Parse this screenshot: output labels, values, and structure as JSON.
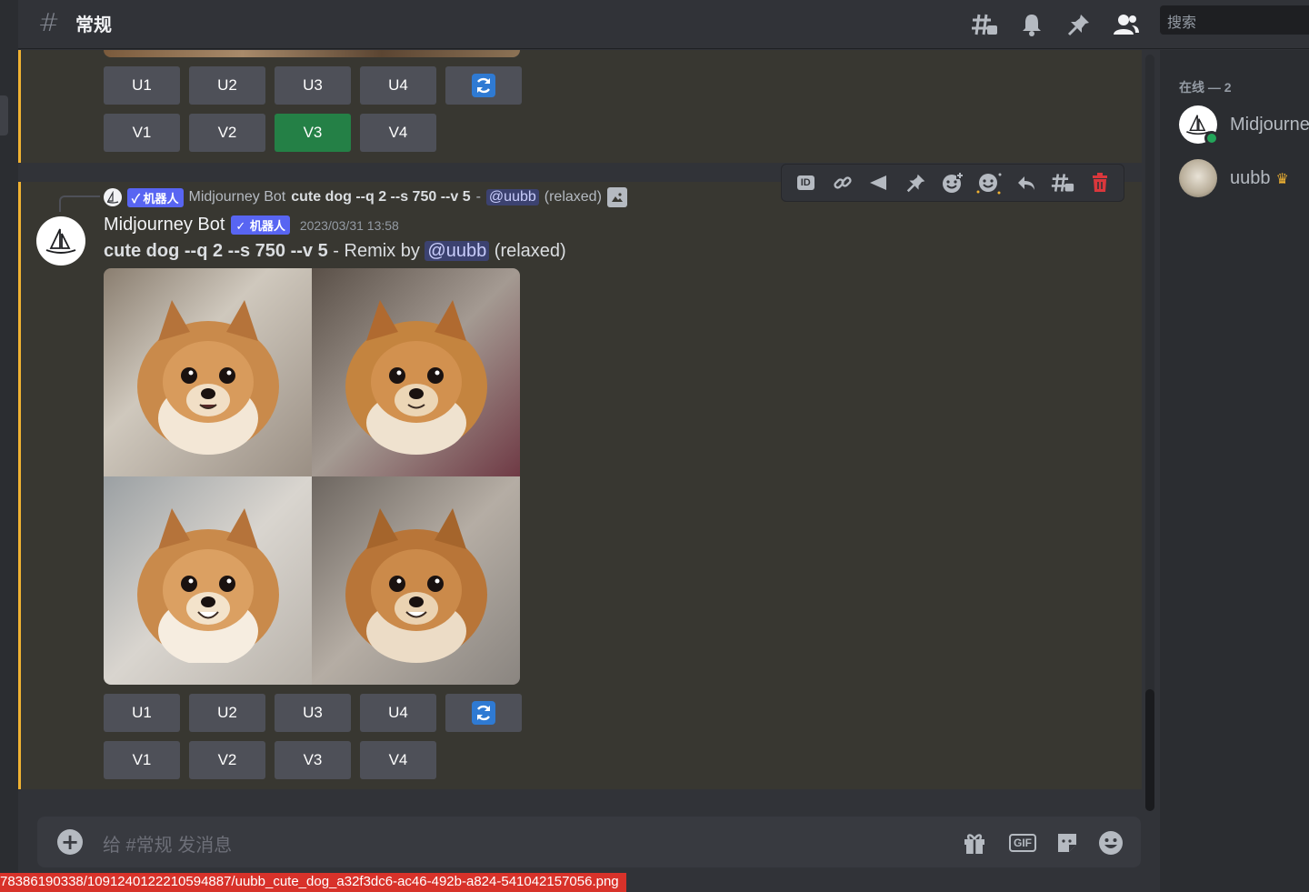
{
  "header": {
    "channel_name": "常规",
    "search_placeholder": "搜索"
  },
  "previous_message": {
    "upscale_buttons": [
      "U1",
      "U2",
      "U3",
      "U4"
    ],
    "variation_buttons": [
      "V1",
      "V2",
      "V3",
      "V4"
    ],
    "active_variation": "V3"
  },
  "reply": {
    "badge": "✓ 机器人",
    "author": "Midjourney Bot",
    "prompt": "cute dog --q 2 --s 750 --v 5",
    "separator": "-",
    "mention": "@uubb",
    "mode": "(relaxed)"
  },
  "message": {
    "author": "Midjourney Bot",
    "badge": "✓ 机器人",
    "timestamp": "2023/03/31 13:58",
    "prompt": "cute dog --q 2 --s 750 --v 5",
    "remix_text": "- Remix by",
    "mention": "@uubb",
    "mode": "(relaxed)",
    "upscale_buttons": [
      "U1",
      "U2",
      "U3",
      "U4"
    ],
    "variation_buttons": [
      "V1",
      "V2",
      "V3",
      "V4"
    ]
  },
  "toolbar": {
    "id_label": "ID",
    "icons": [
      "id-icon",
      "link-icon",
      "megaphone-icon",
      "pin-icon",
      "add-reaction-icon",
      "super-reaction-icon",
      "reply-icon",
      "thread-icon",
      "delete-icon"
    ]
  },
  "composer": {
    "placeholder": "给 #常规 发消息",
    "gif_label": "GIF"
  },
  "members": {
    "header": "在线 — 2",
    "list": [
      {
        "name": "Midjourney Bot",
        "online": true
      },
      {
        "name": "uubb",
        "owner": true
      }
    ]
  },
  "statusbar": {
    "text": "78386190338/1091240122210594887/uubb_cute_dog_a32f3dc6-ac46-492b-a824-541042157056.png"
  },
  "colors": {
    "accent": "#5865f2",
    "highlight_bar": "#f0b232",
    "active_button": "#248046",
    "danger": "#da373c"
  }
}
